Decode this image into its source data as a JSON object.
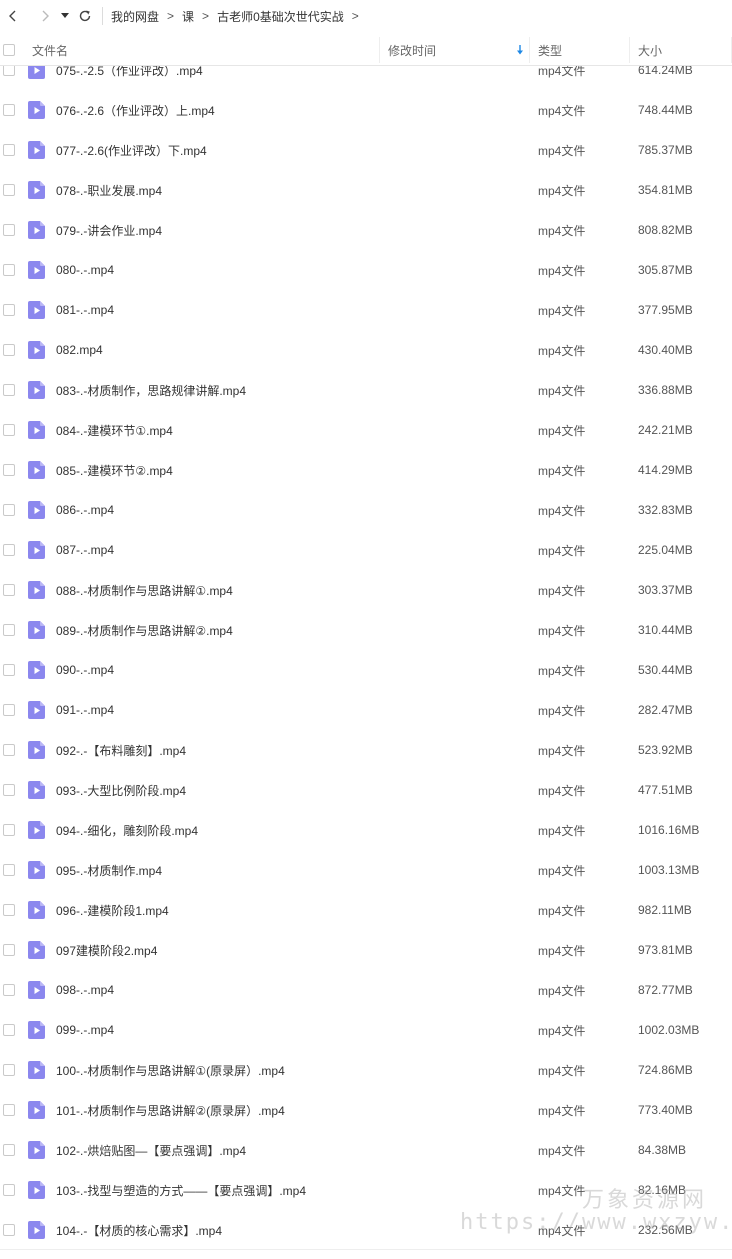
{
  "breadcrumb": {
    "items": [
      "我的网盘",
      "课",
      "古老师0基础次世代实战"
    ],
    "separator": ">"
  },
  "columns": {
    "name": "文件名",
    "mtime": "修改时间",
    "type": "类型",
    "size": "大小"
  },
  "sort": {
    "column": "mtime",
    "direction": "down-arrow-icon"
  },
  "icons": {
    "back": "chevron-left-icon",
    "forward": "chevron-right-icon",
    "history": "caret-down-icon",
    "refresh": "refresh-icon",
    "file": "video-file-icon"
  },
  "colors": {
    "file_icon": "#8b87ee",
    "accent": "#1e88e5"
  },
  "files": [
    {
      "name": "075-.-2.5（作业评改）.mp4",
      "type": "mp4文件",
      "size": "614.24MB"
    },
    {
      "name": "076-.-2.6（作业评改）上.mp4",
      "type": "mp4文件",
      "size": "748.44MB"
    },
    {
      "name": "077-.-2.6(作业评改）下.mp4",
      "type": "mp4文件",
      "size": "785.37MB"
    },
    {
      "name": "078-.-职业发展.mp4",
      "type": "mp4文件",
      "size": "354.81MB"
    },
    {
      "name": "079-.-讲会作业.mp4",
      "type": "mp4文件",
      "size": "808.82MB"
    },
    {
      "name": "080-.-.mp4",
      "type": "mp4文件",
      "size": "305.87MB"
    },
    {
      "name": "081-.-.mp4",
      "type": "mp4文件",
      "size": "377.95MB"
    },
    {
      "name": "082.mp4",
      "type": "mp4文件",
      "size": "430.40MB"
    },
    {
      "name": "083-.-材质制作，思路规律讲解.mp4",
      "type": "mp4文件",
      "size": "336.88MB"
    },
    {
      "name": "084-.-建模环节①.mp4",
      "type": "mp4文件",
      "size": "242.21MB"
    },
    {
      "name": "085-.-建模环节②.mp4",
      "type": "mp4文件",
      "size": "414.29MB"
    },
    {
      "name": "086-.-.mp4",
      "type": "mp4文件",
      "size": "332.83MB"
    },
    {
      "name": "087-.-.mp4",
      "type": "mp4文件",
      "size": "225.04MB"
    },
    {
      "name": "088-.-材质制作与思路讲解①.mp4",
      "type": "mp4文件",
      "size": "303.37MB"
    },
    {
      "name": "089-.-材质制作与思路讲解②.mp4",
      "type": "mp4文件",
      "size": "310.44MB"
    },
    {
      "name": "090-.-.mp4",
      "type": "mp4文件",
      "size": "530.44MB"
    },
    {
      "name": "091-.-.mp4",
      "type": "mp4文件",
      "size": "282.47MB"
    },
    {
      "name": "092-.-【布料雕刻】.mp4",
      "type": "mp4文件",
      "size": "523.92MB"
    },
    {
      "name": "093-.-大型比例阶段.mp4",
      "type": "mp4文件",
      "size": "477.51MB"
    },
    {
      "name": "094-.-细化，雕刻阶段.mp4",
      "type": "mp4文件",
      "size": "1016.16MB"
    },
    {
      "name": "095-.-材质制作.mp4",
      "type": "mp4文件",
      "size": "1003.13MB"
    },
    {
      "name": "096-.-建模阶段1.mp4",
      "type": "mp4文件",
      "size": "982.11MB"
    },
    {
      "name": "097建模阶段2.mp4",
      "type": "mp4文件",
      "size": "973.81MB"
    },
    {
      "name": "098-.-.mp4",
      "type": "mp4文件",
      "size": "872.77MB"
    },
    {
      "name": "099-.-.mp4",
      "type": "mp4文件",
      "size": "1002.03MB"
    },
    {
      "name": "100-.-材质制作与思路讲解①(原录屏）.mp4",
      "type": "mp4文件",
      "size": "724.86MB"
    },
    {
      "name": "101-.-材质制作与思路讲解②(原录屏）.mp4",
      "type": "mp4文件",
      "size": "773.40MB"
    },
    {
      "name": "102-.-烘焙贴图—【要点强调】.mp4",
      "type": "mp4文件",
      "size": "84.38MB"
    },
    {
      "name": "103-.-找型与塑造的方式——【要点强调】.mp4",
      "type": "mp4文件",
      "size": "82.16MB"
    },
    {
      "name": "104-.-【材质的核心需求】.mp4",
      "type": "mp4文件",
      "size": "232.56MB"
    }
  ],
  "watermark": {
    "text": "万象资源网",
    "url": "https://www.wxzyw.com"
  }
}
